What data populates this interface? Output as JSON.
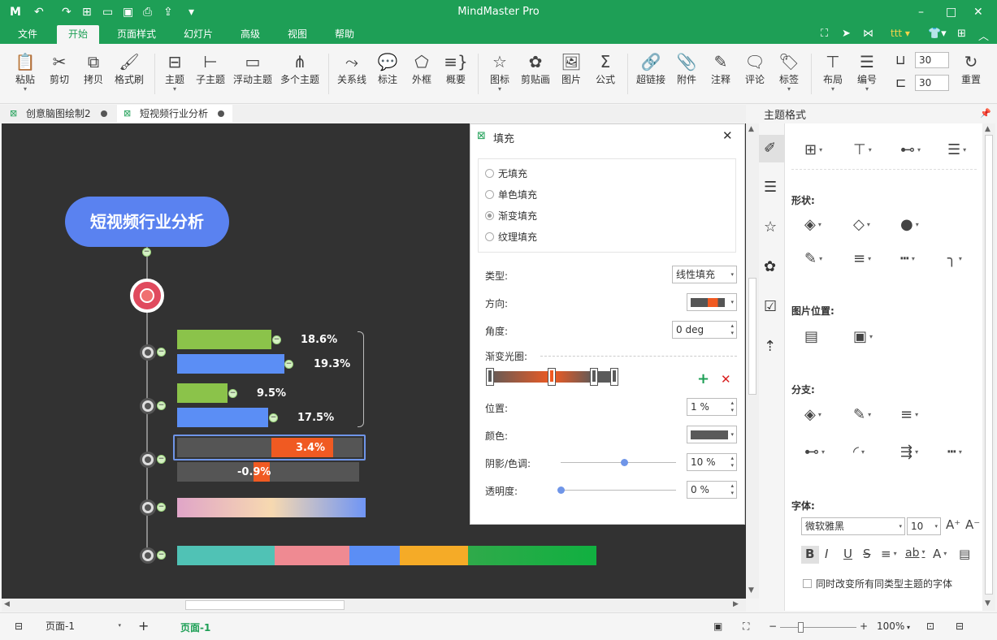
{
  "app": {
    "title": "MindMaster Pro"
  },
  "menu": [
    "文件",
    "开始",
    "页面样式",
    "幻灯片",
    "高级",
    "视图",
    "帮助"
  ],
  "ribbon": {
    "buttons": [
      "粘贴",
      "剪切",
      "拷贝",
      "格式刷",
      "主题",
      "子主题",
      "浮动主题",
      "多个主题",
      "关系线",
      "标注",
      "外框",
      "概要",
      "图标",
      "剪贴画",
      "图片",
      "公式",
      "超链接",
      "附件",
      "注释",
      "评论",
      "标签",
      "布局",
      "编号",
      "重置"
    ],
    "spin1": "30",
    "spin2": "30"
  },
  "tabs": [
    "创意脑图绘制2",
    "短视频行业分析"
  ],
  "canvas": {
    "root": "短视频行业分析",
    "labels": [
      "18.6%",
      "19.3%",
      "9.5%",
      "17.5%",
      "3.4%",
      "-0.9%"
    ]
  },
  "dialog": {
    "title": "填充",
    "fill_options": [
      "无填充",
      "单色填充",
      "渐变填充",
      "纹理填充"
    ],
    "selected_fill": 2,
    "type_label": "类型:",
    "type_value": "线性填充",
    "direction_label": "方向:",
    "angle_label": "角度:",
    "angle_value": "0 deg",
    "gradient_label": "渐变光圈:",
    "position_label": "位置:",
    "position_value": "1 %",
    "color_label": "颜色:",
    "shade_label": "阴影/色调:",
    "shade_value": "10 %",
    "shade_level": 0.55,
    "opacity_label": "透明度:",
    "opacity_value": "0 %",
    "opacity_level": 0.0
  },
  "panel": {
    "title": "主题格式",
    "shape": "形状:",
    "image_pos": "图片位置:",
    "branch": "分支:",
    "font": "字体:",
    "font_name": "微软雅黑",
    "font_size": "10",
    "sync_label": "同时改变所有同类型主题的字体"
  },
  "status": {
    "page_select": "页面-1",
    "page_tab": "页面-1",
    "zoom": "100%"
  },
  "colors": {
    "accent": "#1e9f56",
    "root": "#5a82f0",
    "green_bar": "#8bc34a",
    "blue_bar": "#5b8ef5",
    "orange": "#f05a22"
  }
}
